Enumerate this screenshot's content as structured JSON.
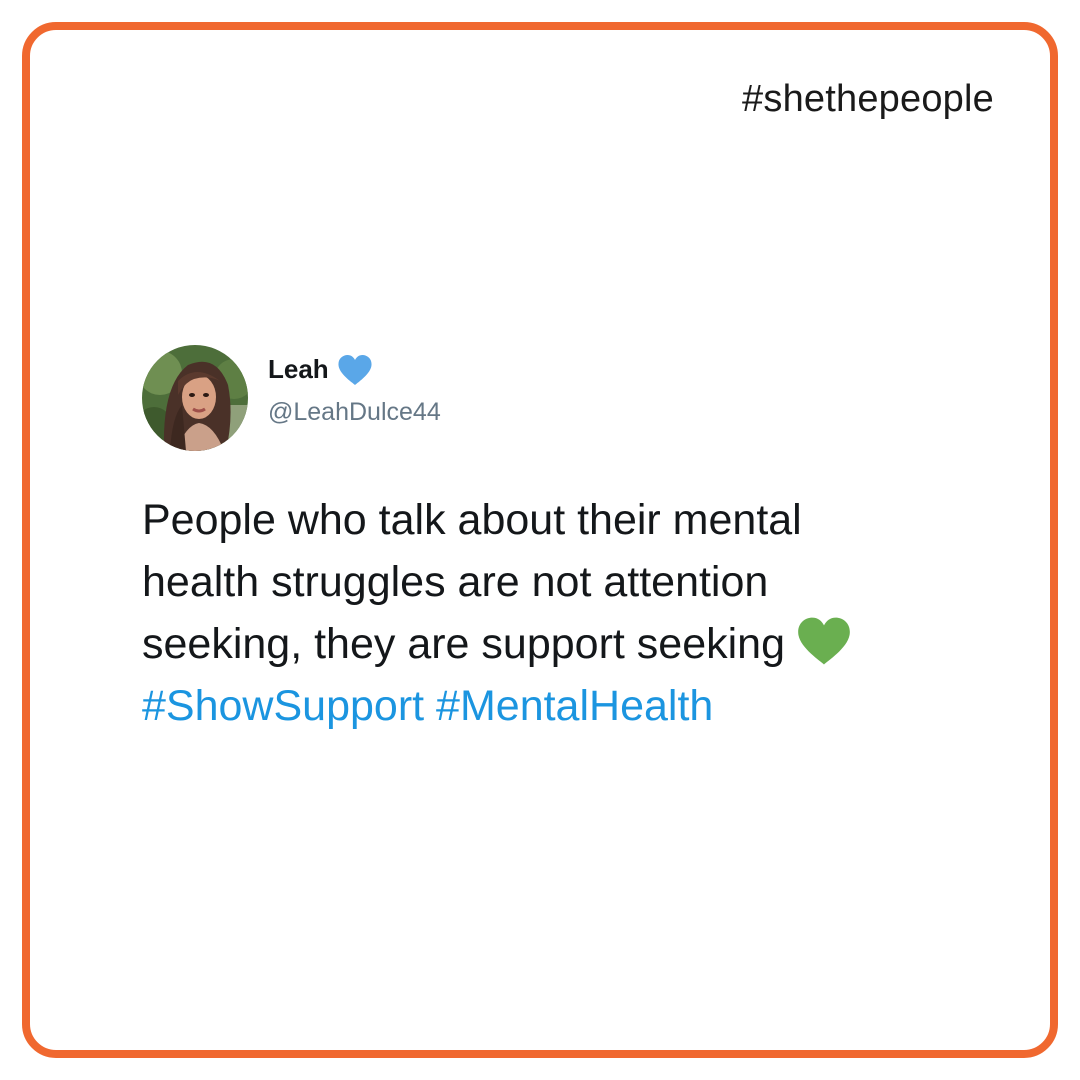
{
  "brand": {
    "hashtag": "#shethepeople",
    "border_color": "#f0682f"
  },
  "tweet": {
    "display_name": "Leah",
    "handle": "@LeahDulce44",
    "name_badge_icon": "blue-heart-icon",
    "text_lines": [
      "People who talk about their mental",
      "health struggles are not attention",
      "seeking, they are support seeking"
    ],
    "text_end_icon": "green-heart-icon",
    "hashtags": [
      "#ShowSupport",
      "#MentalHealth"
    ],
    "colors": {
      "text": "#14171a",
      "handle": "#657786",
      "hashtag": "#1b95e0",
      "blue_heart": "#5aa7e8",
      "green_heart": "#6aaf50"
    }
  }
}
